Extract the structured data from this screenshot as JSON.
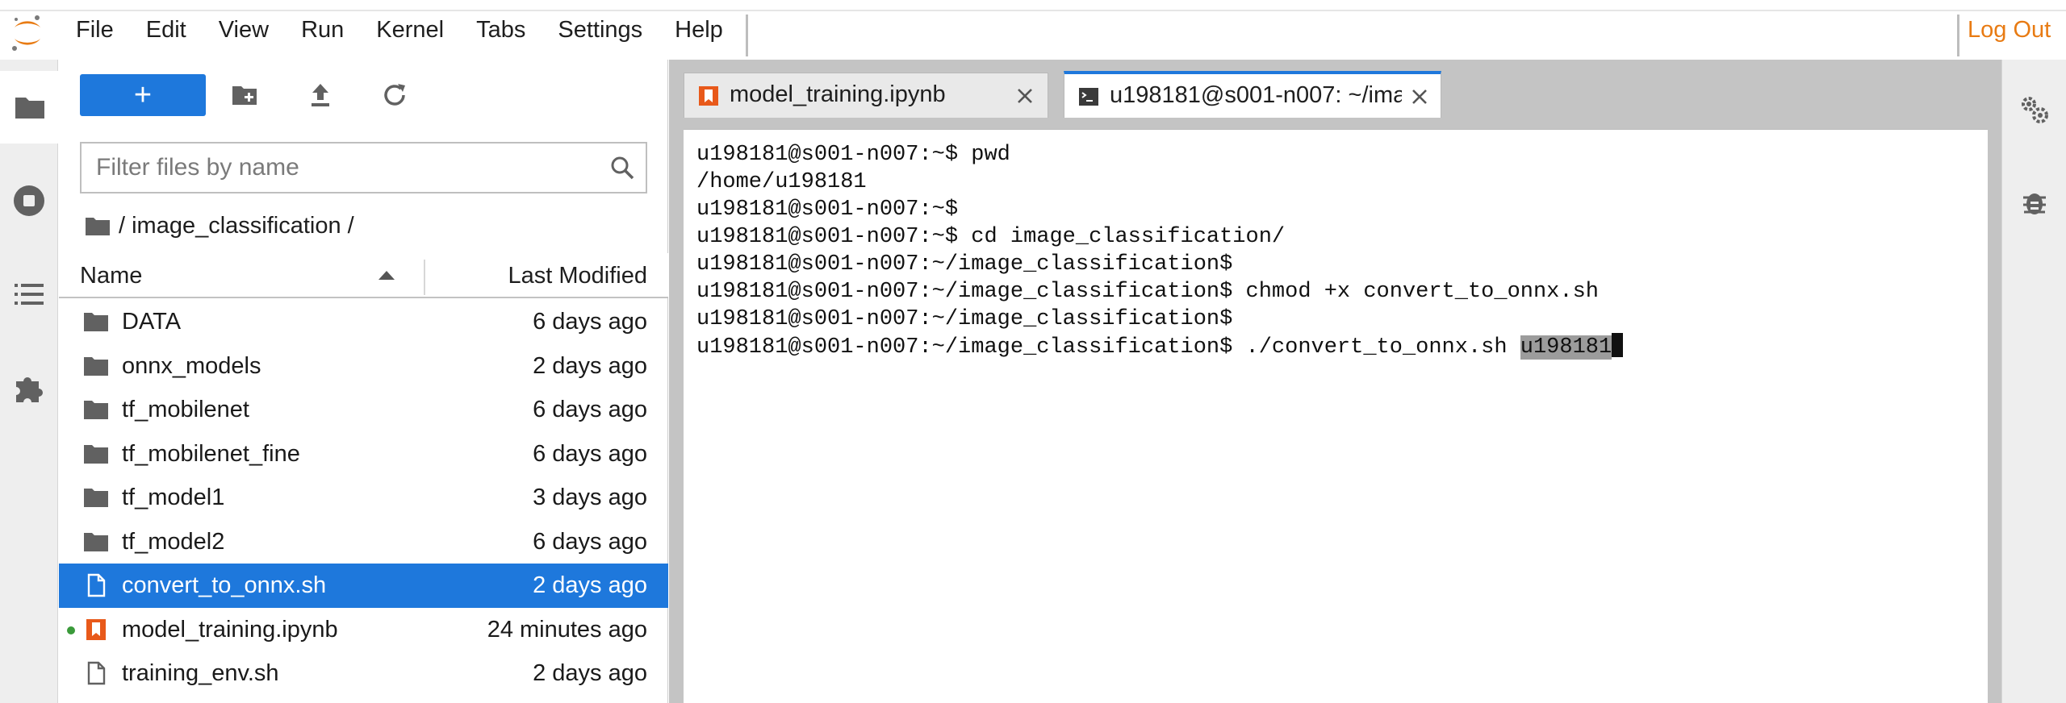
{
  "menu": {
    "items": [
      "File",
      "Edit",
      "View",
      "Run",
      "Kernel",
      "Tabs",
      "Settings",
      "Help"
    ],
    "logout": "Log Out"
  },
  "left_rail": {
    "icons": [
      "folder-icon",
      "running-stop-icon",
      "table-of-contents-icon",
      "extension-puzzle-icon"
    ]
  },
  "file_browser": {
    "new_button_label": "+",
    "filter_placeholder": "Filter files by name",
    "breadcrumb": "/ image_classification /",
    "header": {
      "name": "Name",
      "last_modified": "Last Modified"
    },
    "files": [
      {
        "name": "DATA",
        "modified": "6 days ago",
        "type": "folder"
      },
      {
        "name": "onnx_models",
        "modified": "2 days ago",
        "type": "folder"
      },
      {
        "name": "tf_mobilenet",
        "modified": "6 days ago",
        "type": "folder"
      },
      {
        "name": "tf_mobilenet_fine",
        "modified": "6 days ago",
        "type": "folder"
      },
      {
        "name": "tf_model1",
        "modified": "3 days ago",
        "type": "folder"
      },
      {
        "name": "tf_model2",
        "modified": "6 days ago",
        "type": "folder"
      },
      {
        "name": "convert_to_onnx.sh",
        "modified": "2 days ago",
        "type": "file",
        "selected": true
      },
      {
        "name": "model_training.ipynb",
        "modified": "24 minutes ago",
        "type": "notebook",
        "running": true
      },
      {
        "name": "training_env.sh",
        "modified": "2 days ago",
        "type": "file"
      }
    ]
  },
  "tabs": [
    {
      "label": "model_training.ipynb",
      "icon": "notebook-icon"
    },
    {
      "label": "u198181@s001-n007: ~/ima",
      "icon": "terminal-icon",
      "active": true
    }
  ],
  "terminal": {
    "lines": [
      "u198181@s001-n007:~$ pwd",
      "/home/u198181",
      "u198181@s001-n007:~$",
      "u198181@s001-n007:~$ cd image_classification/",
      "u198181@s001-n007:~/image_classification$",
      "u198181@s001-n007:~/image_classification$ chmod +x convert_to_onnx.sh",
      "u198181@s001-n007:~/image_classification$"
    ],
    "last_prompt": "u198181@s001-n007:~/image_classification$ ./convert_to_onnx.sh ",
    "last_selected": "u198181"
  },
  "colors": {
    "accent": "#1e78dc",
    "logout": "#e87b13",
    "notebook": "#e8591a",
    "running": "#3a9a3a"
  }
}
